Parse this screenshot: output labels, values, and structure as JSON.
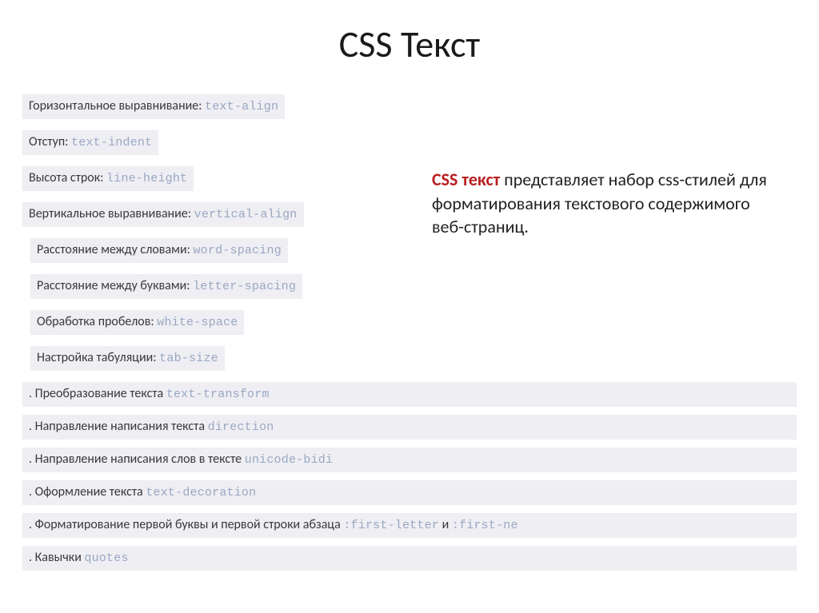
{
  "title": "CSS Текст",
  "description": {
    "heading": "CSS текст",
    "body": " представляет набор css-стилей для форматирования текстового содержимого веб-страниц."
  },
  "left": [
    {
      "label": "Горизонтальное выравнивание: ",
      "code": "text-align"
    },
    {
      "label": "Отступ: ",
      "code": "text-indent"
    },
    {
      "label": "Высота строк: ",
      "code": "line-height"
    },
    {
      "label": "Вертикальное выравнивание: ",
      "code": "vertical-align"
    },
    {
      "label": "Расстояние между словами: ",
      "code": "word-spacing"
    },
    {
      "label": "Расстояние между буквами: ",
      "code": "letter-spacing"
    },
    {
      "label": "Обработка пробелов: ",
      "code": "white-space"
    },
    {
      "label": "Настройка табуляции: ",
      "code": "tab-size"
    }
  ],
  "full": [
    {
      "dot": ". ",
      "label": "Преобразование текста ",
      "code": "text-transform"
    },
    {
      "dot": ". ",
      "label": "Направление написания текста ",
      "code": "direction"
    },
    {
      "dot": ". ",
      "label": "Направление написания слов в тексте ",
      "code": "unicode-bidi"
    },
    {
      "dot": ". ",
      "label": "Оформление текста ",
      "code": "text-decoration"
    },
    {
      "dot": ". ",
      "label": "Форматирование первой буквы и первой строки абзаца ",
      "code1": ":first-letter",
      "conn": " и ",
      "code2": ":first-ne"
    },
    {
      "dot": ". ",
      "label": "Кавычки ",
      "code": "quotes"
    }
  ]
}
